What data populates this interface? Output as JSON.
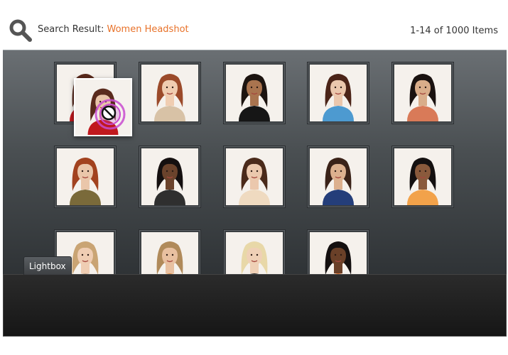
{
  "header": {
    "search_prefix": "Search Result: ",
    "search_term": "Women Headshot",
    "result_count": "1-14 of 1000 Items"
  },
  "colors": {
    "accent": "#e8722a",
    "panel_top": "#6a6f73",
    "panel_bottom": "#2f3336"
  },
  "icons": {
    "search": "magnifier-icon",
    "no_drop": "no-drop-icon"
  },
  "lightbox": {
    "tab_label": "Lightbox"
  },
  "thumbnails": [
    {
      "hair": "#5a2a1c",
      "skin": "#e9c4a8",
      "top": "#c0191e"
    },
    {
      "hair": "#9b4a2a",
      "skin": "#f0cdb1",
      "top": "#d8c2a6"
    },
    {
      "hair": "#1c1410",
      "skin": "#a9744f",
      "top": "#161616"
    },
    {
      "hair": "#4b2418",
      "skin": "#ebc7ad",
      "top": "#4d9ad0"
    },
    {
      "hair": "#1a1210",
      "skin": "#d9ad8a",
      "top": "#d97a58"
    },
    {
      "hair": "#a2421f",
      "skin": "#eac6aa",
      "top": "#7a6a3a"
    },
    {
      "hair": "#151010",
      "skin": "#6b432c",
      "top": "#2f2f2f"
    },
    {
      "hair": "#4a2a1a",
      "skin": "#ebc8ad",
      "top": "#efdac0"
    },
    {
      "hair": "#3a2218",
      "skin": "#dcb08e",
      "top": "#243e7a"
    },
    {
      "hair": "#141010",
      "skin": "#8a5a3c",
      "top": "#f2a24a"
    },
    {
      "hair": "#c9a474",
      "skin": "#efcdb3",
      "top": "#c7a68a"
    },
    {
      "hair": "#b08a5a",
      "skin": "#e8c0a0",
      "top": "#e08a3a"
    },
    {
      "hair": "#e8d8a8",
      "skin": "#efd0b6",
      "top": "#222222"
    },
    {
      "hair": "#141010",
      "skin": "#6a4028",
      "top": "#e06a22"
    }
  ]
}
